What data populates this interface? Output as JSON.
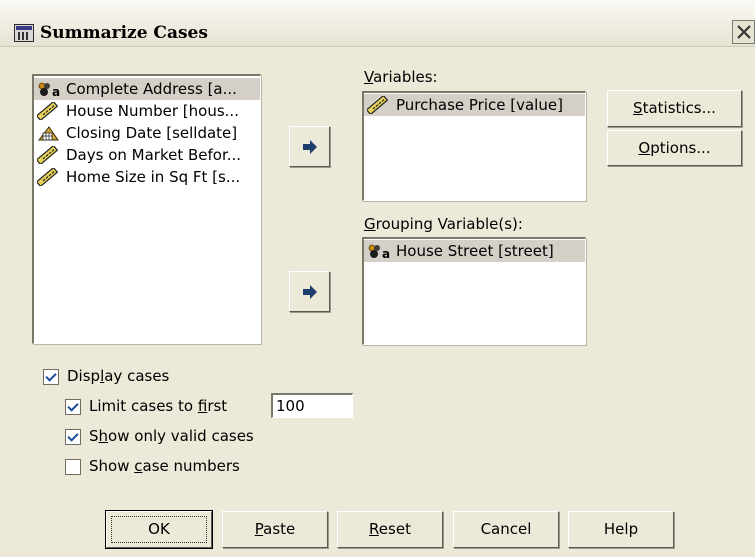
{
  "window": {
    "title": "Summarize Cases",
    "close_symbol": "✕"
  },
  "source_variables": [
    {
      "label": "Complete Address [a...",
      "icon": "nominal-string-icon",
      "selected": true
    },
    {
      "label": "House Number [hous...",
      "icon": "scale-ruler-icon"
    },
    {
      "label": "Closing Date [selldate]",
      "icon": "date-calendar-icon"
    },
    {
      "label": "Days on Market Befor...",
      "icon": "scale-ruler-icon"
    },
    {
      "label": "Home Size in Sq Ft [s...",
      "icon": "scale-ruler-icon"
    }
  ],
  "variables_panel": {
    "label_mnemonic": "V",
    "label_rest": "ariables:",
    "items": [
      {
        "label": "Purchase Price [value]",
        "icon": "scale-ruler-icon"
      }
    ]
  },
  "grouping_panel": {
    "label_mnemonic": "G",
    "label_rest": "rouping Variable(s):",
    "items": [
      {
        "label": "House Street [street]",
        "icon": "nominal-string-icon"
      }
    ]
  },
  "side_buttons": {
    "statistics_mnemonic": "S",
    "statistics_rest": "tatistics...",
    "options_mnemonic": "O",
    "options_rest": "ptions..."
  },
  "options": {
    "display_cases": {
      "pre": "Disp",
      "mnemonic": "l",
      "post": "ay cases",
      "checked": true
    },
    "limit_cases": {
      "pre": "Limit cases to ",
      "mnemonic": "f",
      "post": "irst",
      "checked": true,
      "value": "100"
    },
    "valid_cases": {
      "pre": "S",
      "mnemonic": "h",
      "post": "ow only valid cases",
      "checked": true
    },
    "case_numbers": {
      "pre": "Show ",
      "mnemonic": "c",
      "post": "ase numbers",
      "checked": false
    }
  },
  "footer_buttons": {
    "ok": "OK",
    "paste_mnemonic": "P",
    "paste_rest": "aste",
    "reset_mnemonic": "R",
    "reset_rest": "eset",
    "cancel": "Cancel",
    "help": "Help"
  },
  "colors": {
    "dialog_bg": "#ece9d8",
    "arrow": "#1e3e6e",
    "check": "#1c4da0"
  }
}
